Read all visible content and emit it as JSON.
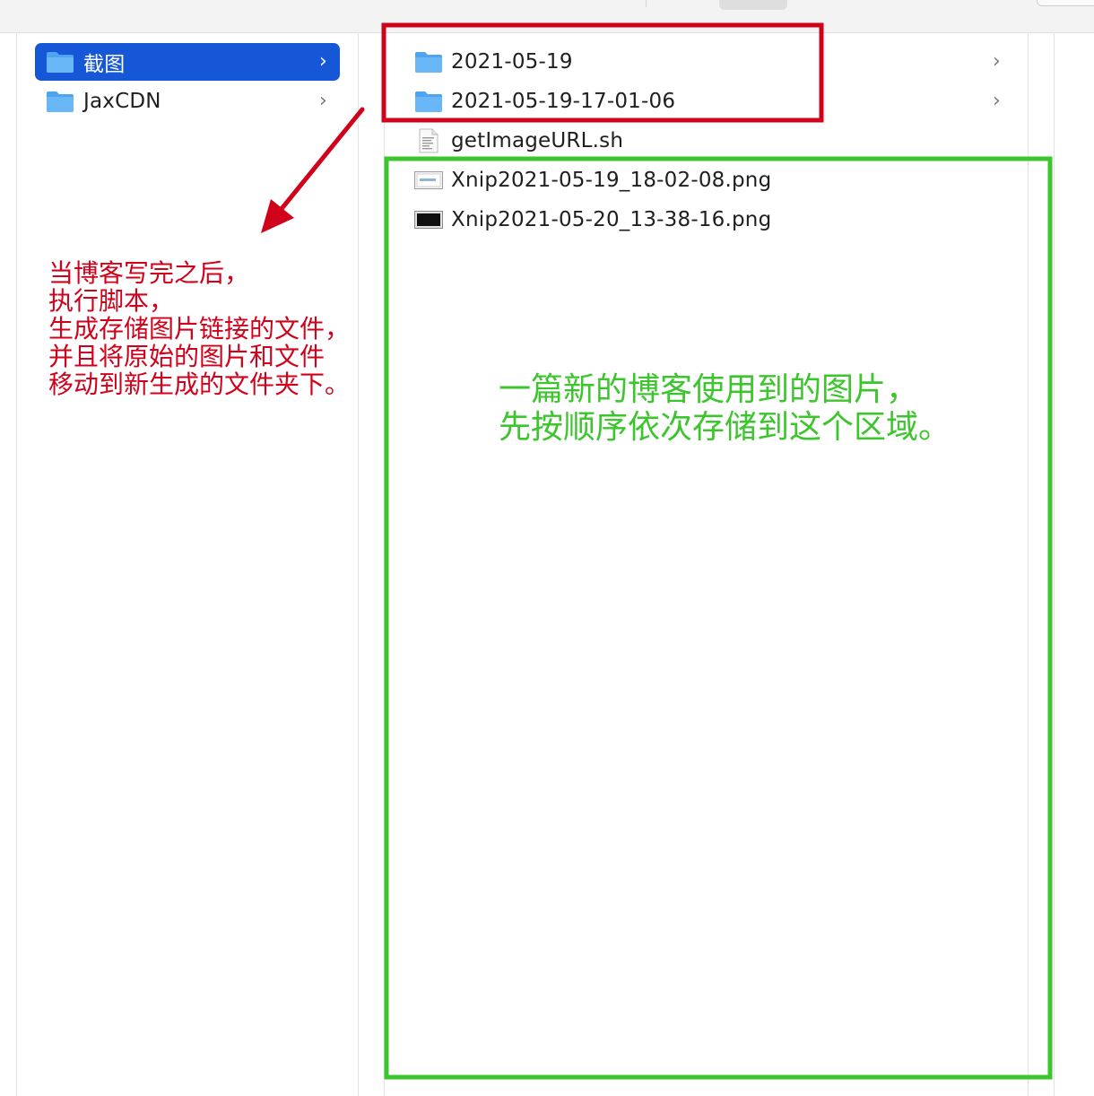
{
  "colors": {
    "selection": "#1557d6",
    "red_annotation": "#d0021b",
    "green_annotation": "#3cc52d",
    "folder_icon": "#4fa4ef"
  },
  "left_column": {
    "items": [
      {
        "label": "截图",
        "icon": "folder-icon",
        "selected": true
      },
      {
        "label": "JaxCDN",
        "icon": "folder-icon",
        "selected": false
      }
    ]
  },
  "right_column": {
    "items": [
      {
        "label": "2021-05-19",
        "icon": "folder-icon"
      },
      {
        "label": "2021-05-19-17-01-06",
        "icon": "folder-icon"
      },
      {
        "label": "getImageURL.sh",
        "icon": "script-file-icon"
      },
      {
        "label": "Xnip2021-05-19_18-02-08.png",
        "icon": "image-file-icon"
      },
      {
        "label": "Xnip2021-05-20_13-38-16.png",
        "icon": "image-file-icon"
      }
    ]
  },
  "annotations": {
    "red_text": "当博客写完之后，\n执行脚本，\n生成存储图片链接的文件，\n并且将原始的图片和文件\n移动到新生成的文件夹下。",
    "green_text": "一篇新的博客使用到的图片，\n先按顺序依次存储到这个区域。"
  }
}
